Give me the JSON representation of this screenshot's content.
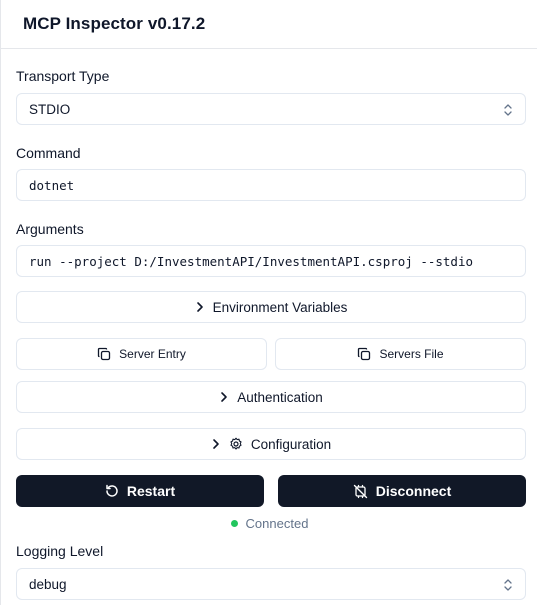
{
  "app": {
    "title": "MCP Inspector v0.17.2"
  },
  "transport": {
    "label": "Transport Type",
    "value": "STDIO"
  },
  "command": {
    "label": "Command",
    "value": "dotnet"
  },
  "arguments": {
    "label": "Arguments",
    "value": "run --project D:/InvestmentAPI/InvestmentAPI.csproj --stdio"
  },
  "sections": {
    "env": "Environment Variables",
    "auth": "Authentication",
    "config": "Configuration"
  },
  "copy_buttons": {
    "server_entry": "Server Entry",
    "servers_file": "Servers File"
  },
  "actions": {
    "restart": "Restart",
    "disconnect": "Disconnect"
  },
  "connection": {
    "status": "Connected",
    "status_color": "#22c55e"
  },
  "logging": {
    "label": "Logging Level",
    "value": "debug"
  },
  "colors": {
    "dark_button": "#111827",
    "border": "#e2e8f0",
    "muted_text": "#64748b"
  }
}
